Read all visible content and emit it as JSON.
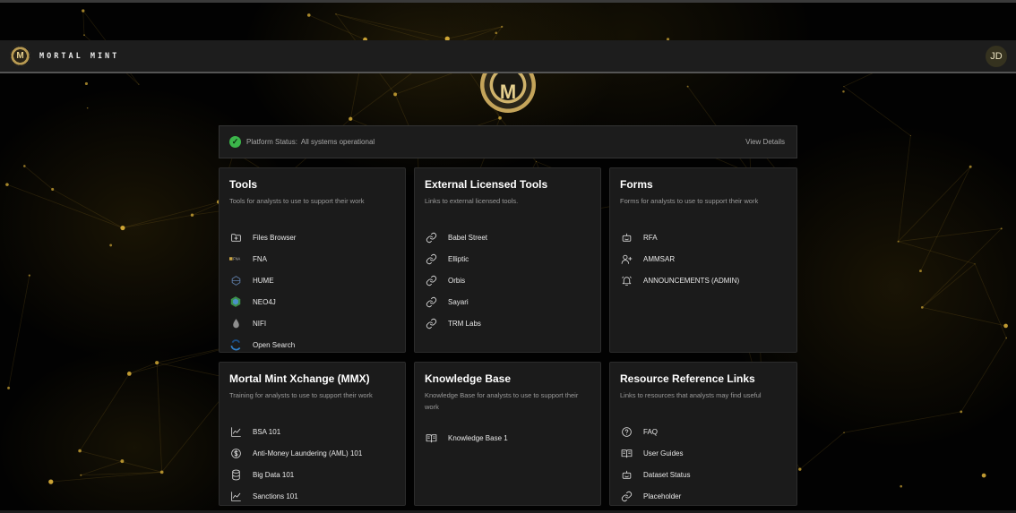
{
  "app": {
    "title": "MORTAL MINT",
    "logo_letter": "M",
    "user_initials": "JD"
  },
  "status": {
    "label": "Platform Status:",
    "value": "All systems operational",
    "details_link": "View Details"
  },
  "colors": {
    "accent_gold": "#c7a85e",
    "status_ok": "#3bb54a",
    "card_bg": "#1b1b1b"
  },
  "cards": {
    "tools": {
      "title": "Tools",
      "description": "Tools for analysts to use to support their work",
      "items": [
        {
          "label": "Files Browser",
          "icon": "folder-plus-icon"
        },
        {
          "label": "FNA",
          "icon": "fna-logo-icon"
        },
        {
          "label": "HUME",
          "icon": "hume-logo-icon"
        },
        {
          "label": "NEO4J",
          "icon": "neo4j-logo-icon"
        },
        {
          "label": "NIFI",
          "icon": "nifi-drop-icon"
        },
        {
          "label": "Open Search",
          "icon": "opensearch-logo-icon"
        }
      ]
    },
    "external": {
      "title": "External Licensed Tools",
      "description": "Links to external licensed tools.",
      "items": [
        {
          "label": "Babel Street",
          "icon": "link-icon"
        },
        {
          "label": "Elliptic",
          "icon": "link-icon"
        },
        {
          "label": "Orbis",
          "icon": "link-icon"
        },
        {
          "label": "Sayari",
          "icon": "link-icon"
        },
        {
          "label": "TRM Labs",
          "icon": "link-icon"
        }
      ]
    },
    "forms": {
      "title": "Forms",
      "description": "Forms for analysts to use to support their work",
      "items": [
        {
          "label": "RFA",
          "icon": "robot-icon"
        },
        {
          "label": "AMMSAR",
          "icon": "user-plus-icon"
        },
        {
          "label": "ANNOUNCEMENTS (ADMIN)",
          "icon": "bell-ringing-icon"
        }
      ]
    },
    "mmx": {
      "title": "Mortal Mint Xchange (MMX)",
      "description": "Training for analysts to use to support their work",
      "items": [
        {
          "label": "BSA 101",
          "icon": "line-chart-icon"
        },
        {
          "label": "Anti-Money Laundering (AML) 101",
          "icon": "dollar-circle-icon"
        },
        {
          "label": "Big Data 101",
          "icon": "database-icon"
        },
        {
          "label": "Sanctions 101",
          "icon": "line-chart-icon"
        }
      ]
    },
    "kb": {
      "title": "Knowledge Base",
      "description": "Knowledge Base for analysts to use to support their work",
      "items": [
        {
          "label": "Knowledge Base 1",
          "icon": "book-icon"
        }
      ]
    },
    "resources": {
      "title": "Resource Reference Links",
      "description": "Links to resources that analysts may find useful",
      "items": [
        {
          "label": "FAQ",
          "icon": "question-circle-icon"
        },
        {
          "label": "User Guides",
          "icon": "book-icon"
        },
        {
          "label": "Dataset Status",
          "icon": "robot-icon"
        },
        {
          "label": "Placeholder",
          "icon": "link-icon"
        }
      ]
    }
  }
}
